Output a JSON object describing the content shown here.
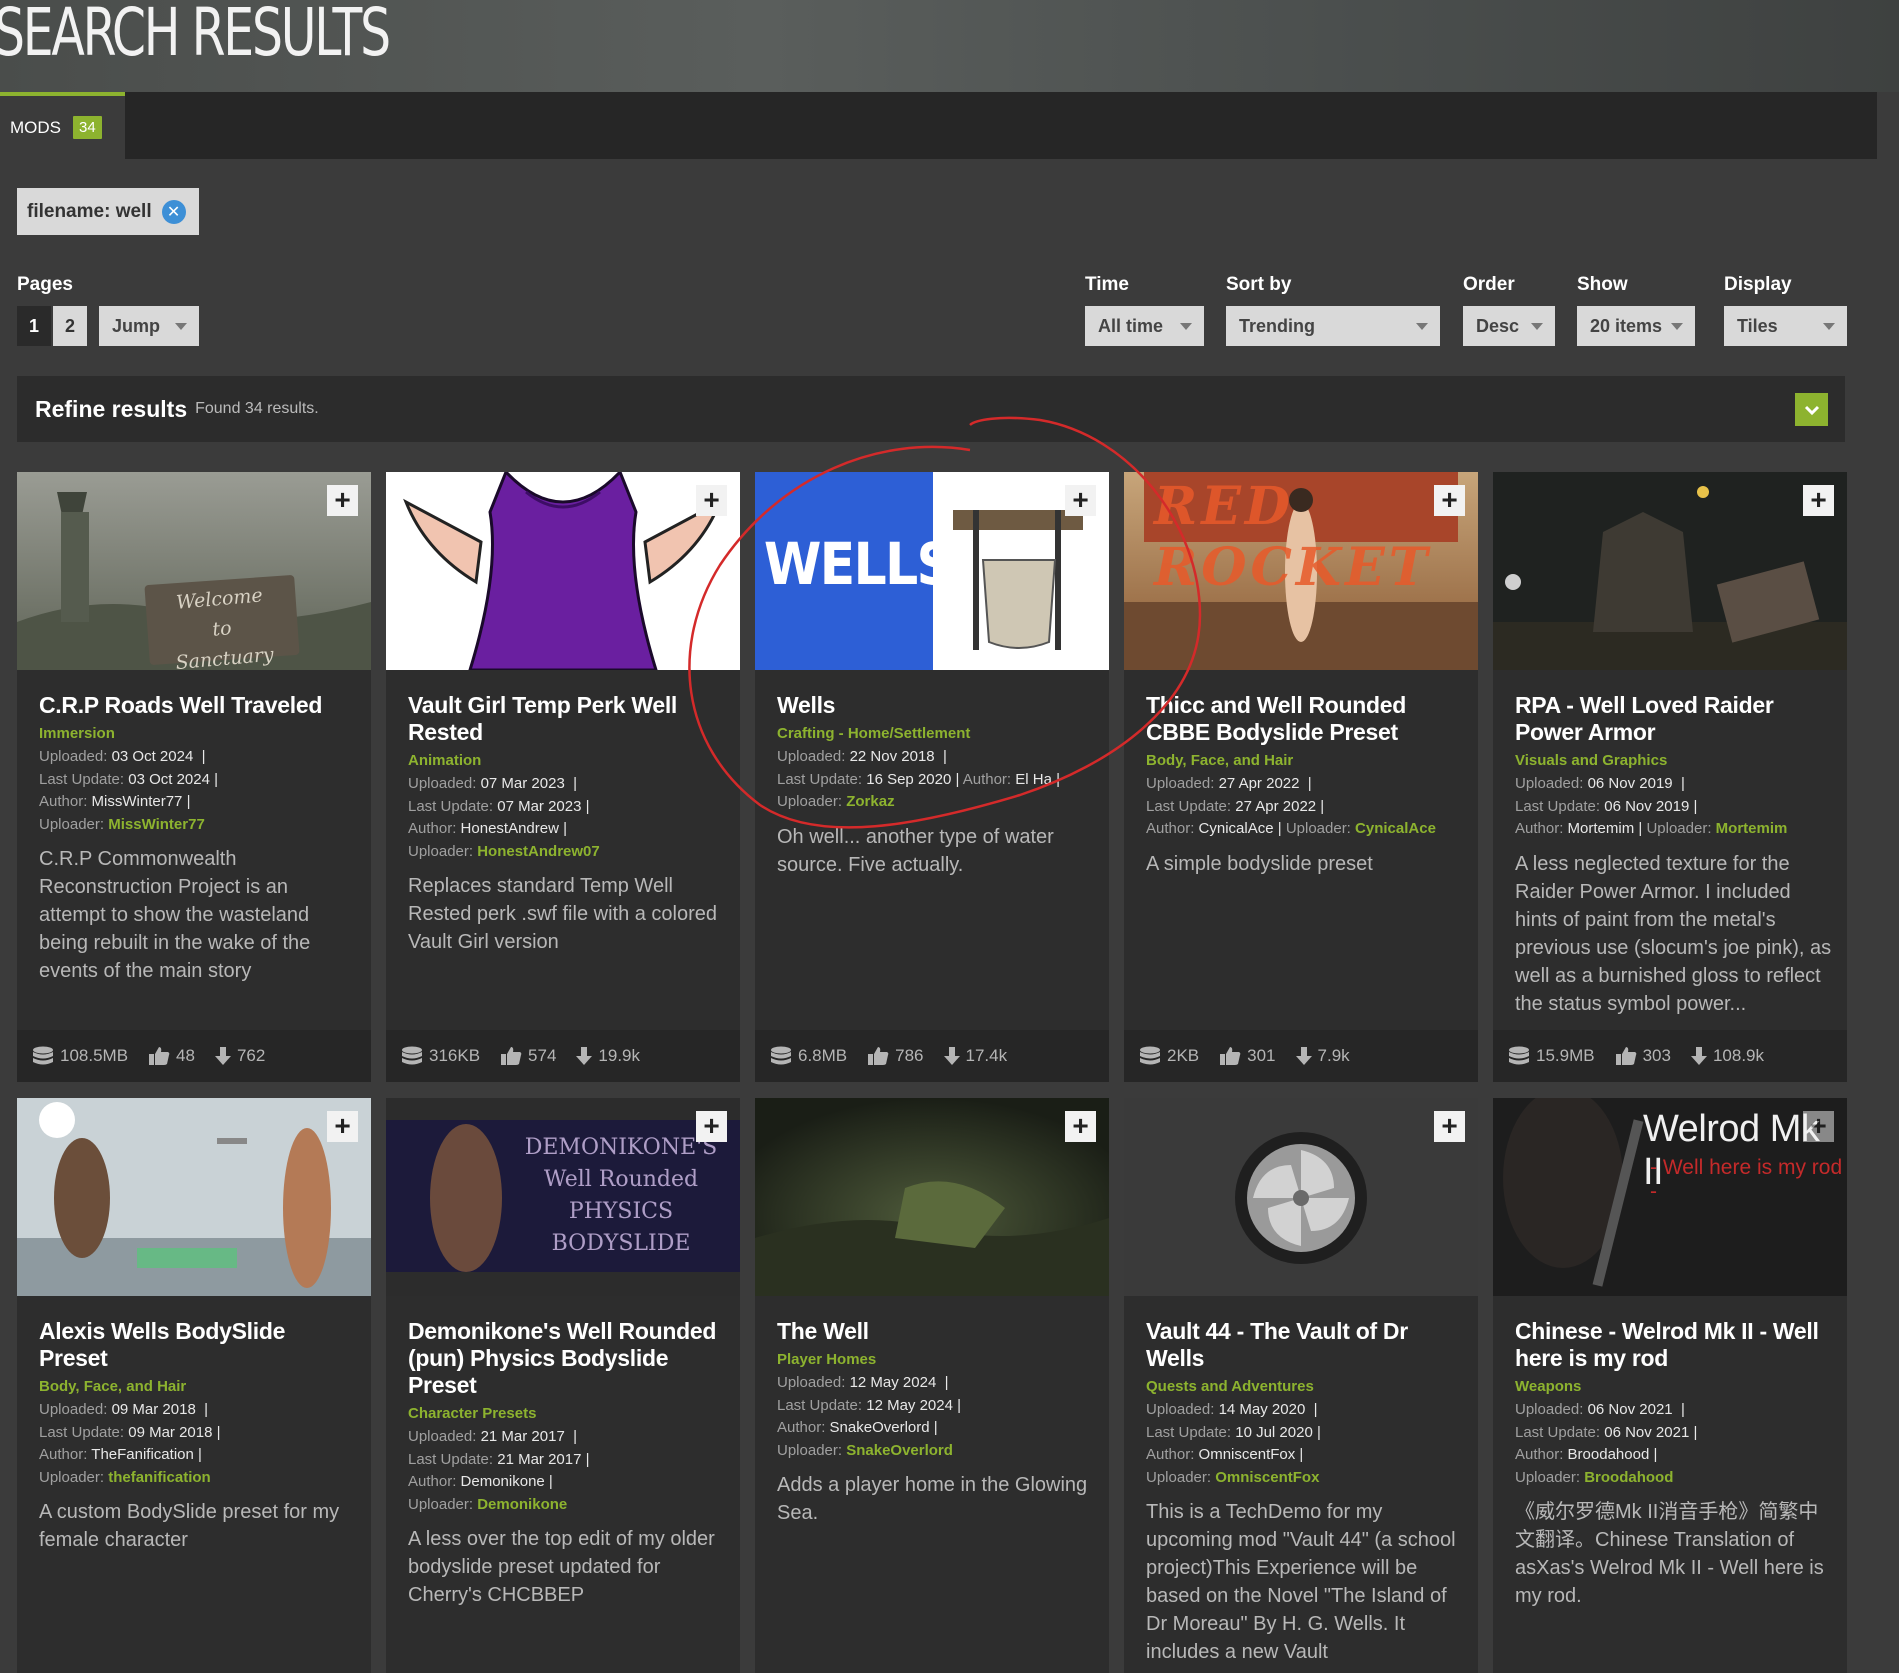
{
  "header": {
    "title": "SEARCH RESULTS"
  },
  "tabs": [
    {
      "label": "MODS",
      "count": "34"
    }
  ],
  "filter": {
    "label": "filename: well"
  },
  "pages": {
    "label": "Pages",
    "items": [
      "1",
      "2"
    ],
    "jump": "Jump"
  },
  "controls": {
    "time": {
      "label": "Time",
      "value": "All time"
    },
    "sort": {
      "label": "Sort by",
      "value": "Trending"
    },
    "order": {
      "label": "Order",
      "value": "Desc"
    },
    "show": {
      "label": "Show",
      "value": "20 items"
    },
    "display": {
      "label": "Display",
      "value": "Tiles"
    }
  },
  "refine": {
    "title": "Refine results",
    "found": "Found 34 results."
  },
  "meta_labels": {
    "uploaded": "Uploaded:",
    "updated": "Last Update:",
    "author": "Author:",
    "uploader": "Uploader:"
  },
  "cards": [
    {
      "title": "C.R.P Roads Well Traveled",
      "category": "Immersion",
      "uploaded": "03 Oct 2024",
      "updated": "03 Oct 2024",
      "author": "MissWinter77",
      "uploader": "MissWinter77",
      "description": "C.R.P Commonwealth Reconstruction Project is an attempt to show the wasteland being rebuilt in the wake of the events of the main story",
      "size": "108.5MB",
      "endorsements": "48",
      "downloads": "762",
      "thumb_text": "Welcome to Sanctuary"
    },
    {
      "title": "Vault Girl Temp Perk Well Rested",
      "category": "Animation",
      "uploaded": "07 Mar 2023",
      "updated": "07 Mar 2023",
      "author": "HonestAndrew",
      "uploader": "HonestAndrew07",
      "description": "Replaces standard Temp Well Rested perk .swf file with a colored Vault Girl version",
      "size": "316KB",
      "endorsements": "574",
      "downloads": "19.9k"
    },
    {
      "title": "Wells",
      "category": "Crafting - Home/Settlement",
      "uploaded": "22 Nov 2018",
      "updated": "16 Sep 2020",
      "author": "El Ha",
      "uploader": "Zorkaz",
      "description": "Oh well... another type of water source. Five actually.",
      "size": "6.8MB",
      "endorsements": "786",
      "downloads": "17.4k",
      "thumb_text": "WELLS"
    },
    {
      "title": "Thicc and Well Rounded CBBE Bodyslide Preset",
      "category": "Body, Face, and Hair",
      "uploaded": "27 Apr 2022",
      "updated": "27 Apr 2022",
      "author": "CynicalAce",
      "uploader": "CynicalAce",
      "description": "A simple bodyslide preset",
      "size": "2KB",
      "endorsements": "301",
      "downloads": "7.9k",
      "thumb_text": "RED ROCKET"
    },
    {
      "title": "RPA - Well Loved Raider Power Armor",
      "category": "Visuals and Graphics",
      "uploaded": "06 Nov 2019",
      "updated": "06 Nov 2019",
      "author": "Mortemim",
      "uploader": "Mortemim",
      "description": "A less neglected texture for the Raider Power Armor. I included hints of paint from the metal's previous use (slocum's joe pink), as well as a burnished gloss to reflect the status symbol power...",
      "size": "15.9MB",
      "endorsements": "303",
      "downloads": "108.9k"
    },
    {
      "title": "Alexis Wells BodySlide Preset",
      "category": "Body, Face, and Hair",
      "uploaded": "09 Mar 2018",
      "updated": "09 Mar 2018",
      "author": "TheFanification",
      "uploader": "thefanification",
      "description": "A custom BodySlide preset for my female character"
    },
    {
      "title": "Demonikone's Well Rounded (pun) Physics Bodyslide Preset",
      "category": "Character Presets",
      "uploaded": "21 Mar 2017",
      "updated": "21 Mar 2017",
      "author": "Demonikone",
      "uploader": "Demonikone",
      "description": "A less over the top edit of my older bodyslide preset updated for Cherry's CHCBBEP",
      "thumb_text": "DEMONIKONE'S Well Rounded PHYSICS BODYSLIDE"
    },
    {
      "title": "The Well",
      "category": "Player Homes",
      "uploaded": "12 May 2024",
      "updated": "12 May 2024",
      "author": "SnakeOverlord",
      "uploader": "SnakeOverlord",
      "description": "Adds a player home in the Glowing Sea."
    },
    {
      "title": "Vault 44 - The Vault of Dr Wells",
      "category": "Quests and Adventures",
      "uploaded": "14 May 2020",
      "updated": "10 Jul 2020",
      "author": "OmniscentFox",
      "uploader": "OmniscentFox",
      "description": "This is a TechDemo for my upcoming mod \"Vault 44\" (a school project)This Experience will be based on the Novel \"The Island of Dr Moreau\" By H. G. Wells. It includes a new Vault"
    },
    {
      "title": "Chinese - Welrod Mk II - Well here is my rod",
      "category": "Weapons",
      "uploaded": "06 Nov 2021",
      "updated": "06 Nov 2021",
      "author": "Broodahood",
      "uploader": "Broodahood",
      "description": "《威尔罗德Mk II消音手枪》简繁中文翻译。Chinese Translation of asXas's Welrod Mk II - Well here is my rod.",
      "thumb_text": "Welrod Mk II",
      "thumb_sub": "- Well here is my rod -"
    }
  ],
  "colors": {
    "accent": "#8db32f",
    "background": "#3b3b3b",
    "card": "#2d2d2d",
    "annotation": "#d42a2a"
  }
}
